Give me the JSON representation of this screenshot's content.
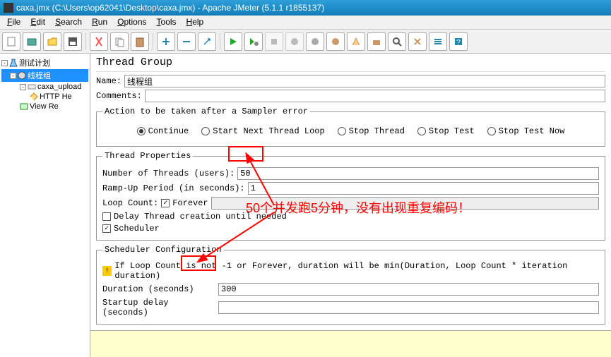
{
  "title": "caxa.jmx (C:\\Users\\op62041\\Desktop\\caxa.jmx) - Apache JMeter (5.1.1 r1855137)",
  "menu": [
    "File",
    "Edit",
    "Search",
    "Run",
    "Options",
    "Tools",
    "Help"
  ],
  "tree": {
    "root": "测试计划",
    "thread_group": "线程组",
    "controller": "caxa_upload",
    "http": "HTTP He",
    "view": "View Re"
  },
  "panel": {
    "header": "Thread Group",
    "name_label": "Name:",
    "name_value": "线程组",
    "comments_label": "Comments:",
    "comments_value": "",
    "action_legend": "Action to be taken after a Sampler error",
    "radios": {
      "continue": "Continue",
      "next_loop": "Start Next Thread Loop",
      "stop_thread": "Stop Thread",
      "stop_test": "Stop Test",
      "stop_now": "Stop Test Now"
    },
    "thread_props_legend": "Thread Properties",
    "num_threads_label": "Number of Threads (users):",
    "num_threads_value": "50",
    "rampup_label": "Ramp-Up Period (in seconds):",
    "rampup_value": "1",
    "loop_label": "Loop Count:",
    "forever_label": "Forever",
    "loop_value": "",
    "delay_label": "Delay Thread creation until needed",
    "scheduler_label": "Scheduler",
    "sched_legend": "Scheduler Configuration",
    "sched_warn": "If Loop Count is not -1 or Forever, duration will be min(Duration, Loop Count * iteration duration)",
    "duration_label": "Duration (seconds)",
    "duration_value": "300",
    "startup_label": "Startup delay (seconds)",
    "startup_value": ""
  },
  "annotation": "50个并发跑5分钟，没有出现重复编码！"
}
